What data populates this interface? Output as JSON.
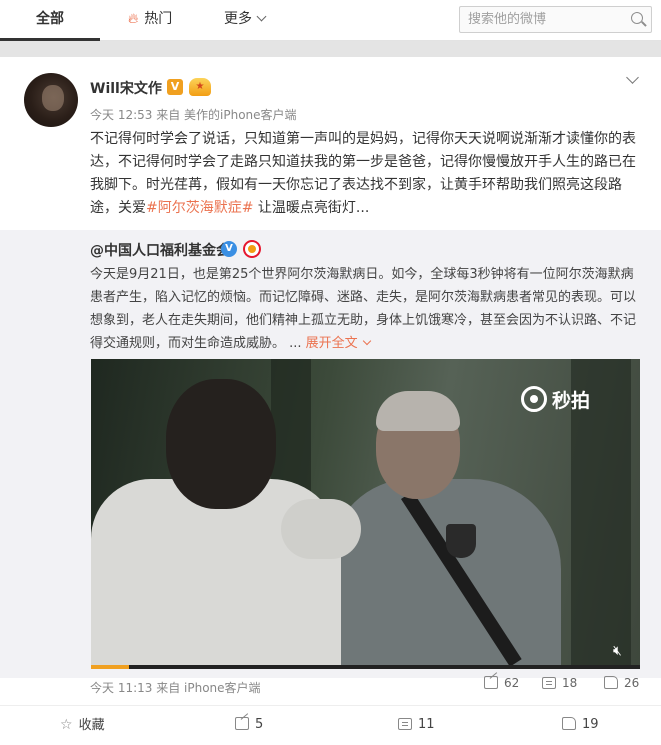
{
  "tabs": {
    "all": "全部",
    "hot": "热门",
    "more": "更多"
  },
  "search": {
    "placeholder": "搜索他的微博"
  },
  "post": {
    "author": "Will宋文作",
    "meta": "今天 12:53 来自 美作的iPhone客户端",
    "text_before_topic": "不记得何时学会了说话，只知道第一声叫的是妈妈，记得你天天说啊说渐渐才读懂你的表达，不记得何时学会了走路只知道扶我的第一步是爸爸，记得你慢慢放开手人生的路已在我脚下。时光荏苒，假如有一天你忘记了表达找不到家，让黄手环帮助我们照亮这段路途，关爱",
    "topic": "#阿尔茨海默症#",
    "text_after_topic": " 让温暖点亮街灯..."
  },
  "repost": {
    "author": "@中国人口福利基金会",
    "text": "今天是9月21日，也是第25个世界阿尔茨海默病日。如今，全球每3秒钟将有一位阿尔茨海默病患者产生，陷入记忆的烦恼。而记忆障碍、迷路、走失，是阿尔茨海默病患者常见的表现。可以想象到，老人在走失期间，他们精神上孤立无助，身体上饥饿寒冷，甚至会因为不认识路、不记得交通规则，而对生命造成威胁。 ...",
    "expand": "展开全文",
    "video": {
      "watermark": "秒拍",
      "progress": 0.07
    },
    "meta": "今天 11:13 来自 iPhone客户端",
    "shares": "62",
    "comments": "18",
    "likes": "26"
  },
  "footer": {
    "favorite": "收藏",
    "shares": "5",
    "comments": "11",
    "likes": "19"
  }
}
